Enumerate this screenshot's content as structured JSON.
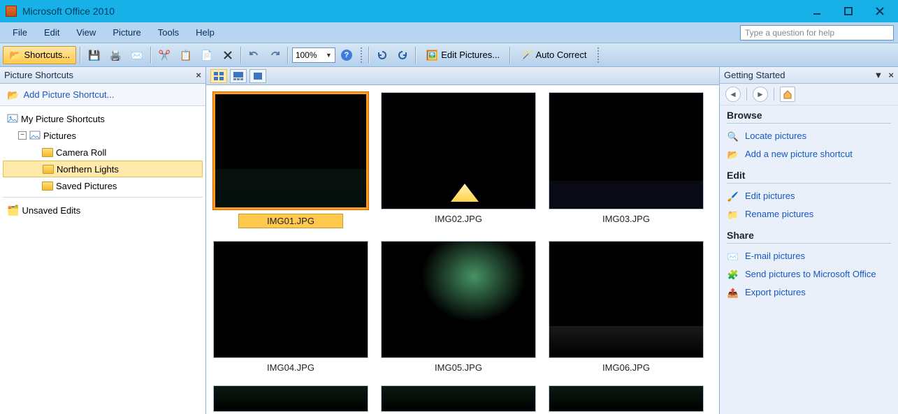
{
  "window": {
    "title": "Microsoft Office 2010"
  },
  "menu": {
    "file": "File",
    "edit": "Edit",
    "view": "View",
    "picture": "Picture",
    "tools": "Tools",
    "help": "Help",
    "help_placeholder": "Type a question for help"
  },
  "toolbar": {
    "shortcuts_label": "Shortcuts...",
    "zoom_value": "100%",
    "edit_pictures_label": "Edit Pictures...",
    "auto_correct_label": "Auto Correct"
  },
  "left_pane": {
    "title": "Picture Shortcuts",
    "add_shortcut": "Add Picture Shortcut...",
    "root": "My Picture Shortcuts",
    "pictures": "Pictures",
    "items": {
      "camera_roll": "Camera Roll",
      "northern_lights": "Northern Lights",
      "saved_pictures": "Saved Pictures"
    },
    "unsaved": "Unsaved Edits"
  },
  "thumbnails": [
    {
      "caption": "IMG01.JPG",
      "selected": true,
      "skin": "sky1"
    },
    {
      "caption": "IMG02.JPG",
      "selected": false,
      "skin": "sky2"
    },
    {
      "caption": "IMG03.JPG",
      "selected": false,
      "skin": "sky3"
    },
    {
      "caption": "IMG04.JPG",
      "selected": false,
      "skin": "sky4"
    },
    {
      "caption": "IMG05.JPG",
      "selected": false,
      "skin": "sky5"
    },
    {
      "caption": "IMG06.JPG",
      "selected": false,
      "skin": "sky6"
    }
  ],
  "task_pane": {
    "title": "Getting Started",
    "browse_heading": "Browse",
    "browse": {
      "locate": "Locate pictures",
      "add_shortcut": "Add a new picture shortcut"
    },
    "edit_heading": "Edit",
    "edit": {
      "edit_pictures": "Edit pictures",
      "rename": "Rename pictures"
    },
    "share_heading": "Share",
    "share": {
      "email": "E-mail pictures",
      "send_office": "Send pictures to Microsoft Office",
      "export": "Export pictures"
    }
  }
}
